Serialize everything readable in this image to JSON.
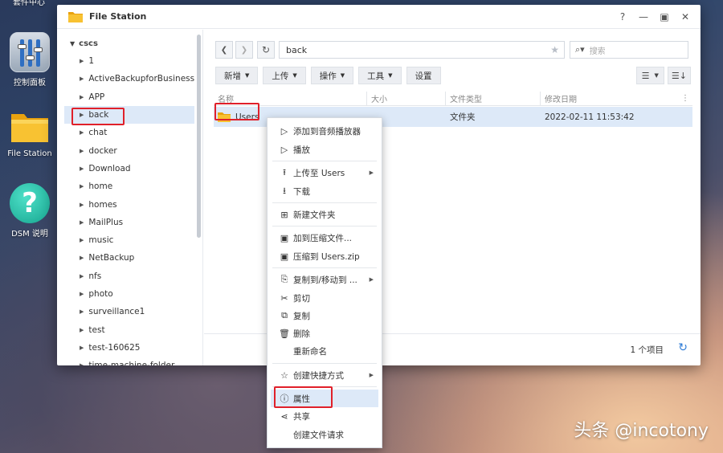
{
  "desktop": {
    "top_label": "套件中心",
    "icons": [
      {
        "label": "控制面板"
      },
      {
        "label": "File Station"
      },
      {
        "label": "DSM 说明"
      }
    ]
  },
  "window": {
    "title": "File Station",
    "controls": {
      "help": "?",
      "minimize": "—",
      "maximize": "▣",
      "close": "✕"
    }
  },
  "tree": {
    "root": "cscs",
    "items": [
      {
        "label": "1"
      },
      {
        "label": "ActiveBackupforBusiness"
      },
      {
        "label": "APP"
      },
      {
        "label": "back"
      },
      {
        "label": "chat"
      },
      {
        "label": "docker"
      },
      {
        "label": "Download"
      },
      {
        "label": "home"
      },
      {
        "label": "homes"
      },
      {
        "label": "MailPlus"
      },
      {
        "label": "music"
      },
      {
        "label": "NetBackup"
      },
      {
        "label": "nfs"
      },
      {
        "label": "photo"
      },
      {
        "label": "surveillance1"
      },
      {
        "label": "test"
      },
      {
        "label": "test-160625"
      },
      {
        "label": "time-machine-folder"
      }
    ]
  },
  "toolbar": {
    "path": "back",
    "search_placeholder": "搜索",
    "buttons": {
      "new": "新增",
      "upload": "上传",
      "action": "操作",
      "tools": "工具",
      "settings": "设置"
    }
  },
  "grid": {
    "columns": {
      "name": "名称",
      "size": "大小",
      "type": "文件类型",
      "modified": "修改日期"
    },
    "rows": [
      {
        "name": "Users",
        "size": "",
        "type": "文件夹",
        "modified": "2022-02-11 11:53:42"
      }
    ]
  },
  "status": {
    "count": "1 个项目"
  },
  "context_menu": {
    "add_to_player": "添加到音频播放器",
    "play": "播放",
    "upload_to": "上传至 Users",
    "download": "下载",
    "new_folder": "新建文件夹",
    "add_to_archive": "加到压缩文件...",
    "compress_to": "压缩到 Users.zip",
    "copy_move": "复制到/移动到 ...",
    "cut": "剪切",
    "copy": "复制",
    "delete": "删除",
    "rename": "重新命名",
    "create_shortcut": "创建快捷方式",
    "properties": "属性",
    "share": "共享",
    "file_request": "创建文件请求"
  },
  "watermark": "头条 @incotony",
  "colors": {
    "highlight_border": "#e0202a",
    "selection": "#dde9f8",
    "accent": "#2d7bd6"
  }
}
